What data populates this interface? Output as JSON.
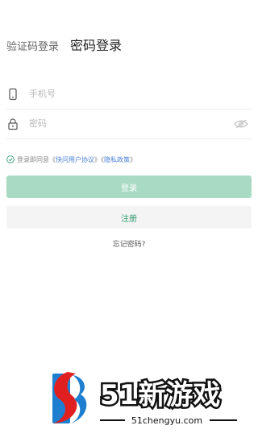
{
  "tabs": {
    "sms_login": "验证码登录",
    "password_login": "密码登录"
  },
  "form": {
    "phone_placeholder": "手机号",
    "password_placeholder": "密码"
  },
  "agreement": {
    "prefix": "登录即同意《",
    "user_agreement": "快问用户协议",
    "middle": "》《",
    "privacy_policy": "隐私政策",
    "suffix": "》"
  },
  "buttons": {
    "login": "登录",
    "register": "注册",
    "forgot": "忘记密码?"
  },
  "watermark": {
    "brand": "51新游戏",
    "site": "51chengyu.com"
  },
  "colors": {
    "accent": "#2f9b6e",
    "login_button": "#a9dbc4",
    "link": "#4a7fd6"
  },
  "icons": [
    "phone-icon",
    "lock-icon",
    "eye-icon",
    "check-circle-icon",
    "logo-icon"
  ]
}
